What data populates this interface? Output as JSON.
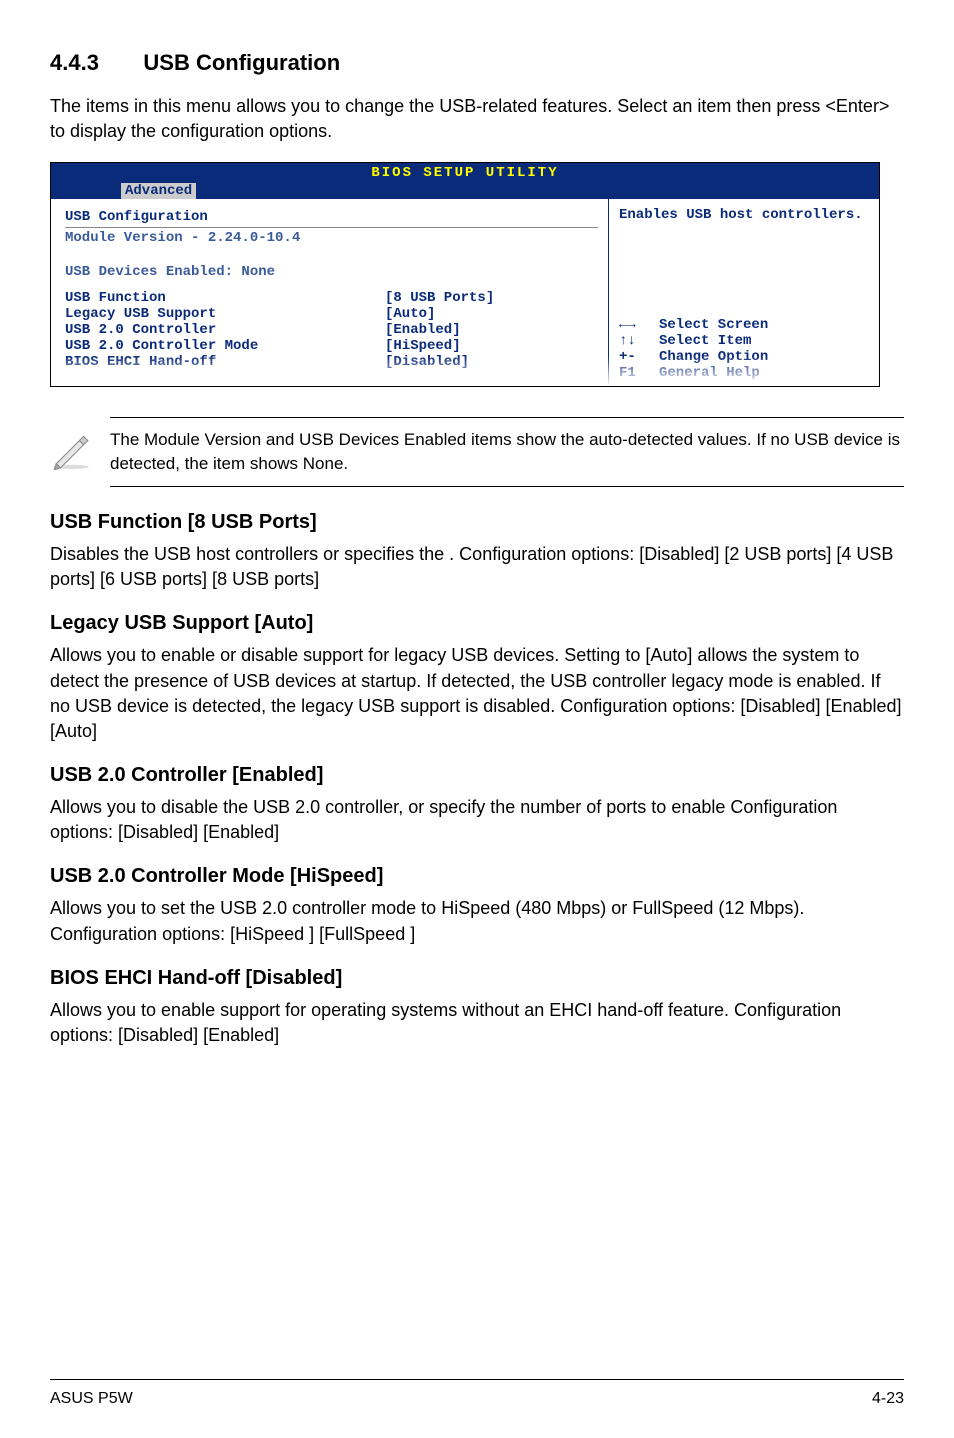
{
  "section": {
    "number": "4.4.3",
    "title": "USB Configuration"
  },
  "intro": "The items in this menu allows you to change the USB-related features. Select an item then press <Enter> to display the configuration options.",
  "bios": {
    "header": "BIOS SETUP UTILITY",
    "tab": "Advanced",
    "leftTitle": "USB Configuration",
    "module": "Module Version - 2.24.0-10.4",
    "devices": "USB Devices Enabled: None",
    "rows": [
      {
        "label": "USB Function",
        "value": "[8 USB Ports]"
      },
      {
        "label": "Legacy USB Support",
        "value": "[Auto]"
      },
      {
        "label": "USB 2.0 Controller",
        "value": "[Enabled]"
      },
      {
        "label": "USB 2.0 Controller Mode",
        "value": "[HiSpeed]"
      },
      {
        "label": "BIOS EHCI Hand-off",
        "value": "[Disabled]"
      }
    ],
    "help": "Enables USB host controllers.",
    "nav": [
      {
        "key": "←→",
        "label": "Select Screen"
      },
      {
        "key": "↑↓",
        "label": "Select Item"
      },
      {
        "key": "+-",
        "label": "Change Option"
      },
      {
        "key": "F1",
        "label": "General Help"
      }
    ]
  },
  "note": "The Module Version and USB Devices Enabled items show the auto-detected values. If no USB device is detected, the item shows None.",
  "subs": [
    {
      "heading": "USB Function [8 USB Ports]",
      "text": "Disables the USB host controllers or specifies the .\nConfiguration options: [Disabled] [2 USB ports] [4 USB ports] [6 USB ports]  [8 USB ports]"
    },
    {
      "heading": "Legacy USB Support [Auto]",
      "text": "Allows you to enable or disable support for legacy USB devices. Setting to [Auto] allows the system to detect the presence of USB devices at startup. If detected, the USB controller legacy mode is enabled. If no USB device is detected, the legacy USB support is disabled. Configuration options: [Disabled] [Enabled] [Auto]"
    },
    {
      "heading": "USB 2.0 Controller [Enabled]",
      "text": "Allows you to disable the USB 2.0 controller, or specify the number of ports to enable Configuration options: [Disabled] [Enabled]"
    },
    {
      "heading": "USB 2.0 Controller Mode [HiSpeed]",
      "text": "Allows you to set the USB 2.0 controller mode to HiSpeed (480 Mbps) or FullSpeed (12 Mbps). Configuration options: [HiSpeed ] [FullSpeed ]"
    },
    {
      "heading": "BIOS EHCI Hand-off [Disabled]",
      "text": "Allows you to enable support for operating systems without an EHCI hand-off feature. Configuration options: [Disabled] [Enabled]"
    }
  ],
  "footer": {
    "left": "ASUS P5W",
    "right": "4-23"
  }
}
